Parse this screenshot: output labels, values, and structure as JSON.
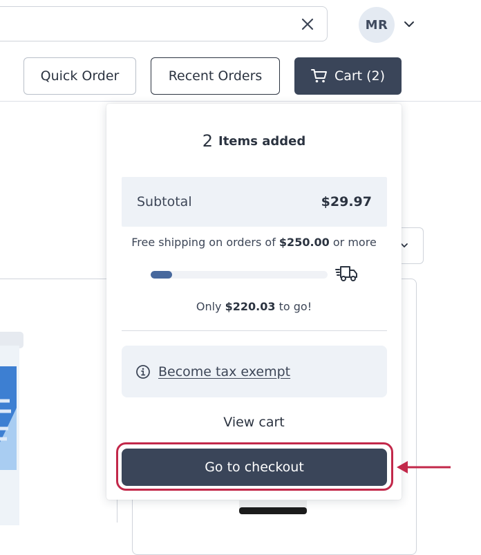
{
  "header": {
    "search": {
      "value": "",
      "placeholder": ""
    },
    "user": {
      "initials": "MR"
    },
    "nav": {
      "quick_order": "Quick Order",
      "recent_orders": "Recent Orders",
      "cart_label": "Cart (2)"
    }
  },
  "cart_panel": {
    "items_count": "2",
    "items_label": "Items added",
    "subtotal_label": "Subtotal",
    "subtotal_value": "$29.97",
    "shipping": {
      "prefix": "Free shipping on orders of",
      "threshold": "$250.00",
      "suffix": "or more",
      "progress_fraction": 0.12
    },
    "to_go": {
      "prefix": "Only",
      "amount": "$220.03",
      "suffix": "to go!"
    },
    "tax_exempt_label": "Become tax exempt",
    "view_cart_label": "View cart",
    "checkout_label": "Go to checkout"
  },
  "colors": {
    "primary_dark": "#3a4559",
    "progress": "#47689d",
    "highlight": "#c2284a",
    "panel_bg": "#eef2f7"
  },
  "icons": [
    "close-icon",
    "chevron-down-icon",
    "cart-icon",
    "truck-icon",
    "info-icon",
    "arrow-left-icon"
  ]
}
